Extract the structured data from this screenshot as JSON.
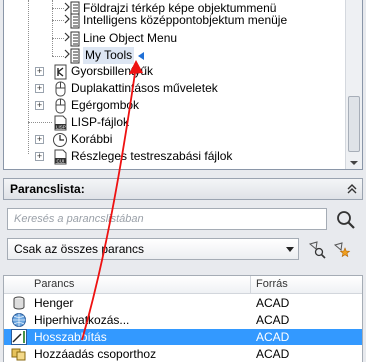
{
  "tree": {
    "items": [
      {
        "label": "Földrajzi térkép képe objektummenü"
      },
      {
        "label": "Intelligens középpontobjektum menüje"
      },
      {
        "label": "Line Object Menu"
      },
      {
        "label": "My Tools"
      },
      {
        "label": "Gyorsbillentyűk"
      },
      {
        "label": "Duplakattintásos műveletek"
      },
      {
        "label": "Egérgombok"
      },
      {
        "label": "LISP-fájlok"
      },
      {
        "label": "Korábbi"
      },
      {
        "label": "Részleges testreszabási fájlok"
      }
    ]
  },
  "command_list": {
    "title": "Parancslista:",
    "search_placeholder": "Keresés a parancslistában",
    "filter_value": "Csak az összes parancs",
    "columns": {
      "command": "Parancs",
      "source": "Forrás"
    },
    "rows": [
      {
        "name": "Henger",
        "source": "ACAD"
      },
      {
        "name": "Hiperhivatkozás...",
        "source": "ACAD"
      },
      {
        "name": "Hosszabbítás",
        "source": "ACAD"
      },
      {
        "name": "Hozzáadás csoporthoz",
        "source": "ACAD"
      }
    ]
  },
  "colors": {
    "selection": "#3399ff",
    "annotation_arrow": "#ee1111"
  }
}
